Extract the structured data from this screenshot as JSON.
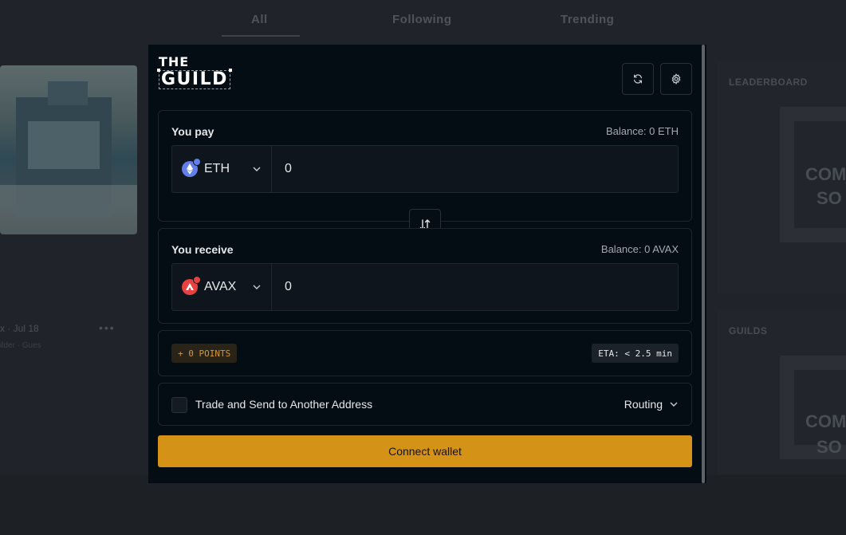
{
  "background": {
    "tabs": [
      "All",
      "Following",
      "Trending"
    ],
    "right_panels": [
      "LEADERBOARD",
      "GUILDS"
    ],
    "shield_text": [
      "COM",
      "SO"
    ],
    "meta_line": "x · Jul 18",
    "meta_sub": "ilder · Gues"
  },
  "logo": {
    "line1": "THE",
    "line2": "GUILD"
  },
  "header": {
    "refresh_icon": "refresh-icon",
    "settings_icon": "gear-icon"
  },
  "pay": {
    "label": "You pay",
    "balance": "Balance: 0  ETH",
    "token": "ETH",
    "amount": "0"
  },
  "receive": {
    "label": "You receive",
    "balance": "Balance: 0 AVAX",
    "token": "AVAX",
    "amount": "0"
  },
  "info": {
    "points": "+ 0 POINTS",
    "eta": "ETA: < 2.5 min"
  },
  "options": {
    "send_label": "Trade and Send to Another Address",
    "routing": "Routing"
  },
  "actions": {
    "connect": "Connect wallet"
  },
  "colors": {
    "accent": "#d49317",
    "eth": "#627eea",
    "avax": "#e84142",
    "modal_bg": "#040d14"
  }
}
